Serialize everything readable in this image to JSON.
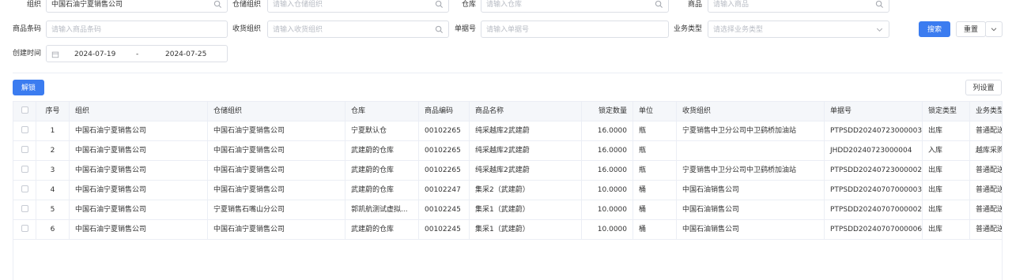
{
  "filters": {
    "org": {
      "label": "组织",
      "value": "中国石油宁夏销售公司"
    },
    "warehouse_org": {
      "label": "仓储组织",
      "placeholder": "请输入仓储组织"
    },
    "warehouse": {
      "label": "仓库",
      "placeholder": "请输入仓库"
    },
    "product": {
      "label": "商品",
      "placeholder": "请输入商品"
    },
    "barcode": {
      "label": "商品条码",
      "placeholder": "请输入商品条码"
    },
    "receiving_org": {
      "label": "收货组织",
      "placeholder": "请输入收货组织"
    },
    "doc_no": {
      "label": "单据号",
      "placeholder": "请输入单据号"
    },
    "biz_type": {
      "label": "业务类型",
      "placeholder": "请选择业务类型"
    },
    "created_time": {
      "label": "创建时间",
      "start": "2024-07-19",
      "sep": "-",
      "end": "2024-07-25"
    }
  },
  "actions": {
    "search": "搜索",
    "reset": "重置",
    "unlock": "解锁",
    "col_settings": "列设置"
  },
  "table": {
    "columns": [
      "序号",
      "组织",
      "仓储组织",
      "仓库",
      "商品编码",
      "商品名称",
      "锁定数量",
      "单位",
      "收货组织",
      "单据号",
      "锁定类型",
      "业务类型"
    ],
    "rows": [
      {
        "no": "1",
        "org": "中国石油宁夏销售公司",
        "wh_org": "中国石油宁夏销售公司",
        "wh": "宁夏默认仓",
        "code": "00102265",
        "name": "纯采越库2武建蔚",
        "qty": "16.0000",
        "unit": "瓶",
        "recv": "宁夏销售中卫分公司中卫鹞桥加油站",
        "doc": "PTPSDD20240723000003",
        "lock": "出库",
        "biz": "普通配送"
      },
      {
        "no": "2",
        "org": "中国石油宁夏销售公司",
        "wh_org": "中国石油宁夏销售公司",
        "wh": "武建蔚的仓库",
        "code": "00102265",
        "name": "纯采越库2武建蔚",
        "qty": "16.0000",
        "unit": "瓶",
        "recv": "",
        "doc": "JHDD20240723000004",
        "lock": "入库",
        "biz": "越库采购"
      },
      {
        "no": "3",
        "org": "中国石油宁夏销售公司",
        "wh_org": "中国石油宁夏销售公司",
        "wh": "武建蔚的仓库",
        "code": "00102265",
        "name": "纯采越库2武建蔚",
        "qty": "16.0000",
        "unit": "瓶",
        "recv": "宁夏销售中卫分公司中卫鹞桥加油站",
        "doc": "PTPSDD20240723000002",
        "lock": "出库",
        "biz": "普通配送"
      },
      {
        "no": "4",
        "org": "中国石油宁夏销售公司",
        "wh_org": "中国石油宁夏销售公司",
        "wh": "武建蔚的仓库",
        "code": "00102247",
        "name": "集采2（武建蔚）",
        "qty": "10.0000",
        "unit": "桶",
        "recv": "中国石油销售公司",
        "doc": "PTPSDD20240707000003",
        "lock": "出库",
        "biz": "普通配送"
      },
      {
        "no": "5",
        "org": "中国石油宁夏销售公司",
        "wh_org": "宁夏销售石嘴山分公司",
        "wh": "郭凯航测试虚拟...",
        "code": "00102245",
        "name": "集采1（武建蔚）",
        "qty": "10.0000",
        "unit": "桶",
        "recv": "中国石油销售公司",
        "doc": "PTPSDD20240707000002",
        "lock": "出库",
        "biz": "普通配送"
      },
      {
        "no": "6",
        "org": "中国石油宁夏销售公司",
        "wh_org": "中国石油宁夏销售公司",
        "wh": "武建蔚的仓库",
        "code": "00102245",
        "name": "集采1（武建蔚）",
        "qty": "10.0000",
        "unit": "桶",
        "recv": "中国石油销售公司",
        "doc": "PTPSDD20240707000006",
        "lock": "出库",
        "biz": "普通配送"
      }
    ]
  },
  "colors": {
    "primary": "#3b7cf0",
    "border": "#dcdfe6",
    "header_bg": "#f5f7fa"
  }
}
